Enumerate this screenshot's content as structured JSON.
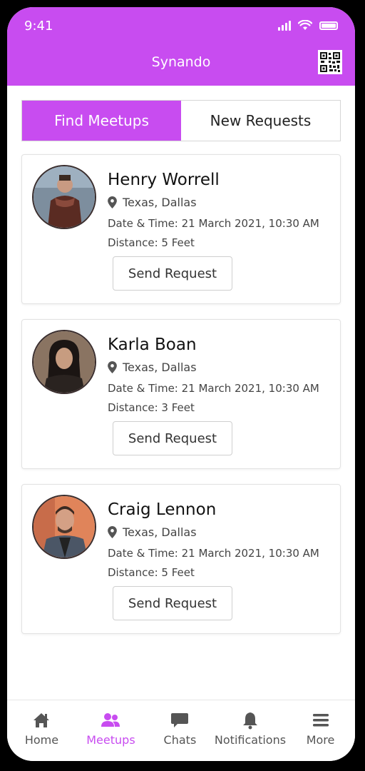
{
  "status_bar": {
    "time": "9:41"
  },
  "header": {
    "title": "Synando"
  },
  "tabs": [
    {
      "label": "Find Meetups",
      "active": true
    },
    {
      "label": "New Requests",
      "active": false
    }
  ],
  "meetups": [
    {
      "name": "Henry Worrell",
      "location": "Texas, Dallas",
      "datetime": "Date & Time: 21 March 2021, 10:30 AM",
      "distance": "Distance: 5 Feet",
      "button": "Send Request"
    },
    {
      "name": "Karla Boan",
      "location": "Texas, Dallas",
      "datetime": "Date & Time: 21 March 2021, 10:30 AM",
      "distance": "Distance: 3 Feet",
      "button": "Send Request"
    },
    {
      "name": "Craig Lennon",
      "location": "Texas, Dallas",
      "datetime": "Date & Time: 21 March 2021, 10:30 AM",
      "distance": "Distance: 5 Feet",
      "button": "Send Request"
    }
  ],
  "bottom_nav": [
    {
      "label": "Home",
      "icon": "home-icon",
      "active": false
    },
    {
      "label": "Meetups",
      "icon": "users-icon",
      "active": true
    },
    {
      "label": "Chats",
      "icon": "chat-icon",
      "active": false
    },
    {
      "label": "Notifications",
      "icon": "bell-icon",
      "active": false
    },
    {
      "label": "More",
      "icon": "menu-icon",
      "active": false
    }
  ],
  "colors": {
    "accent": "#c84cf0",
    "text": "#111111",
    "muted": "#444444"
  }
}
